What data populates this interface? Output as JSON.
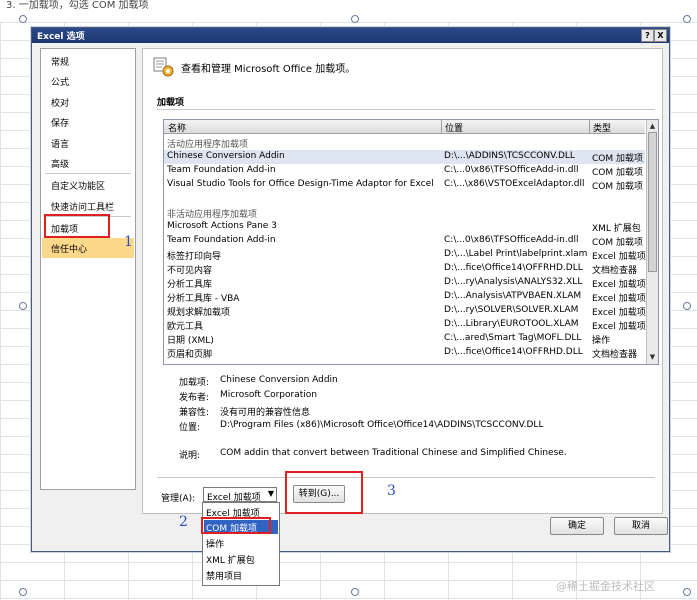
{
  "doc_top_text": "3. 一加载项，勾选 COM 加载项",
  "dialog": {
    "title": "Excel 选项",
    "help_button": "?",
    "close_button": "X"
  },
  "nav": {
    "items": [
      "常规",
      "公式",
      "校对",
      "保存",
      "语言",
      "高级",
      "自定义功能区",
      "快速访问工具栏",
      "加载项",
      "信任中心"
    ]
  },
  "header": {
    "title": "查看和管理 Microsoft Office 加载项。",
    "section": "加载项"
  },
  "table": {
    "columns": [
      "名称",
      "位置",
      "类型"
    ],
    "active_group": "活动应用程序加载项",
    "active_rows": [
      {
        "name": "Chinese Conversion Addin",
        "location": "D:\\...\\ADDINS\\TCSCCONV.DLL",
        "type": "COM 加载项"
      },
      {
        "name": "Team Foundation Add-in",
        "location": "C:\\...0\\x86\\TFSOfficeAdd-in.dll",
        "type": "COM 加载项"
      },
      {
        "name": "Visual Studio Tools for Office Design-Time Adaptor for Excel",
        "location": "C:\\...\\x86\\VSTOExcelAdaptor.dll",
        "type": "COM 加载项"
      }
    ],
    "inactive_group": "非活动应用程序加载项",
    "inactive_rows": [
      {
        "name": "Microsoft Actions Pane 3",
        "location": "",
        "type": "XML 扩展包"
      },
      {
        "name": "Team Foundation Add-in",
        "location": "C:\\...0\\x86\\TFSOfficeAdd-in.dll",
        "type": "COM 加载项"
      },
      {
        "name": "标签打印向导",
        "location": "D:\\...\\Label Print\\labelprint.xlam",
        "type": "Excel 加载项"
      },
      {
        "name": "不可见内容",
        "location": "D:\\...fice\\Office14\\OFFRHD.DLL",
        "type": "文档检查器"
      },
      {
        "name": "分析工具库",
        "location": "D:\\...ry\\Analysis\\ANALYS32.XLL",
        "type": "Excel 加载项"
      },
      {
        "name": "分析工具库 - VBA",
        "location": "D:\\...Analysis\\ATPVBAEN.XLAM",
        "type": "Excel 加载项"
      },
      {
        "name": "规划求解加载项",
        "location": "D:\\...ry\\SOLVER\\SOLVER.XLAM",
        "type": "Excel 加载项"
      },
      {
        "name": "欧元工具",
        "location": "D:\\...Library\\EUROTOOL.XLAM",
        "type": "Excel 加载项"
      },
      {
        "name": "日期 (XML)",
        "location": "C:\\...ared\\Smart Tag\\MOFL.DLL",
        "type": "操作"
      },
      {
        "name": "页眉和页脚",
        "location": "D:\\...fice\\Office14\\OFFRHD.DLL",
        "type": "文档检查器"
      }
    ]
  },
  "details": {
    "addin_label": "加载项:",
    "addin_value": "Chinese Conversion Addin",
    "publisher_label": "发布者:",
    "publisher_value": "Microsoft Corporation",
    "compat_label": "兼容性:",
    "compat_value": "没有可用的兼容性信息",
    "location_label": "位置:",
    "location_value": "D:\\Program Files (x86)\\Microsoft Office\\Office14\\ADDINS\\TCSCCONV.DLL",
    "desc_label": "说明:",
    "desc_value": "COM addin that convert between Traditional Chinese and Simplified Chinese."
  },
  "manage": {
    "label": "管理(A):",
    "selected": "Excel 加载项",
    "go_button": "转到(G)...",
    "options": [
      "Excel 加载项",
      "COM 加载项",
      "操作",
      "XML 扩展包",
      "禁用项目"
    ]
  },
  "buttons": {
    "ok": "确定",
    "cancel": "取消"
  },
  "markers": [
    "1",
    "2",
    "3"
  ],
  "watermark": "@稀土掘金技术社区"
}
